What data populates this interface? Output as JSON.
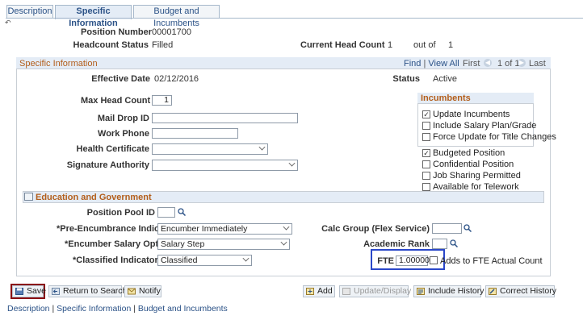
{
  "tabs": [
    {
      "label": "Description"
    },
    {
      "label": "Specific Information"
    },
    {
      "label": "Budget and Incumbents"
    }
  ],
  "header": {
    "position_number_label": "Position Number",
    "position_number": "00001700",
    "headcount_status_label": "Headcount Status",
    "headcount_status": "Filled",
    "current_head_count_label": "Current Head Count",
    "current_head_count": "1",
    "out_of_label": "out of",
    "out_of": "1"
  },
  "panel": {
    "title": "Specific Information",
    "find": "Find",
    "view_all": "View All",
    "first": "First",
    "range": "1 of 1",
    "last": "Last",
    "effective_date_label": "Effective Date",
    "effective_date": "02/12/2016",
    "status_label": "Status",
    "status": "Active"
  },
  "form": {
    "max_head_count_label": "Max Head Count",
    "max_head_count": "1",
    "mail_drop_label": "Mail Drop ID",
    "mail_drop": "",
    "work_phone_label": "Work Phone",
    "work_phone": "",
    "health_cert_label": "Health Certificate",
    "health_cert": "",
    "signature_auth_label": "Signature Authority",
    "signature_auth": ""
  },
  "incumbents": {
    "title": "Incumbents",
    "update_incumbents": "Update Incumbents",
    "include_salary": "Include Salary Plan/Grade",
    "force_update": "Force Update for Title Changes"
  },
  "flags": {
    "budgeted": "Budgeted Position",
    "confidential": "Confidential Position",
    "job_sharing": "Job Sharing Permitted",
    "telework": "Available for Telework"
  },
  "education": {
    "title": "Education and Government",
    "position_pool_label": "Position Pool ID",
    "position_pool": "",
    "pre_enc_label": "*Pre-Encumbrance Indicator",
    "pre_enc": "Encumber Immediately",
    "enc_salary_label": "*Encumber Salary Option",
    "enc_salary": "Salary Step",
    "classified_label": "*Classified Indicator",
    "classified": "Classified",
    "calc_group_label": "Calc Group (Flex Service)",
    "calc_group": "",
    "academic_rank_label": "Academic Rank",
    "academic_rank": "",
    "fte_label": "FTE",
    "fte": "1.000000",
    "adds_to_fte": "Adds to FTE Actual Count"
  },
  "toolbar": {
    "save": "Save",
    "return_to_search": "Return to Search",
    "notify": "Notify",
    "add": "Add",
    "update_display": "Update/Display",
    "include_history": "Include History",
    "correct_history": "Correct History"
  },
  "bottom_links": [
    {
      "label": "Description"
    },
    {
      "label": "Specific Information"
    },
    {
      "label": "Budget and Incumbents"
    }
  ],
  "colors": {
    "accent": "#b35e1b",
    "link": "#2b5287",
    "save_highlight": "#8b0f12",
    "fte_highlight": "#2a47c9"
  }
}
